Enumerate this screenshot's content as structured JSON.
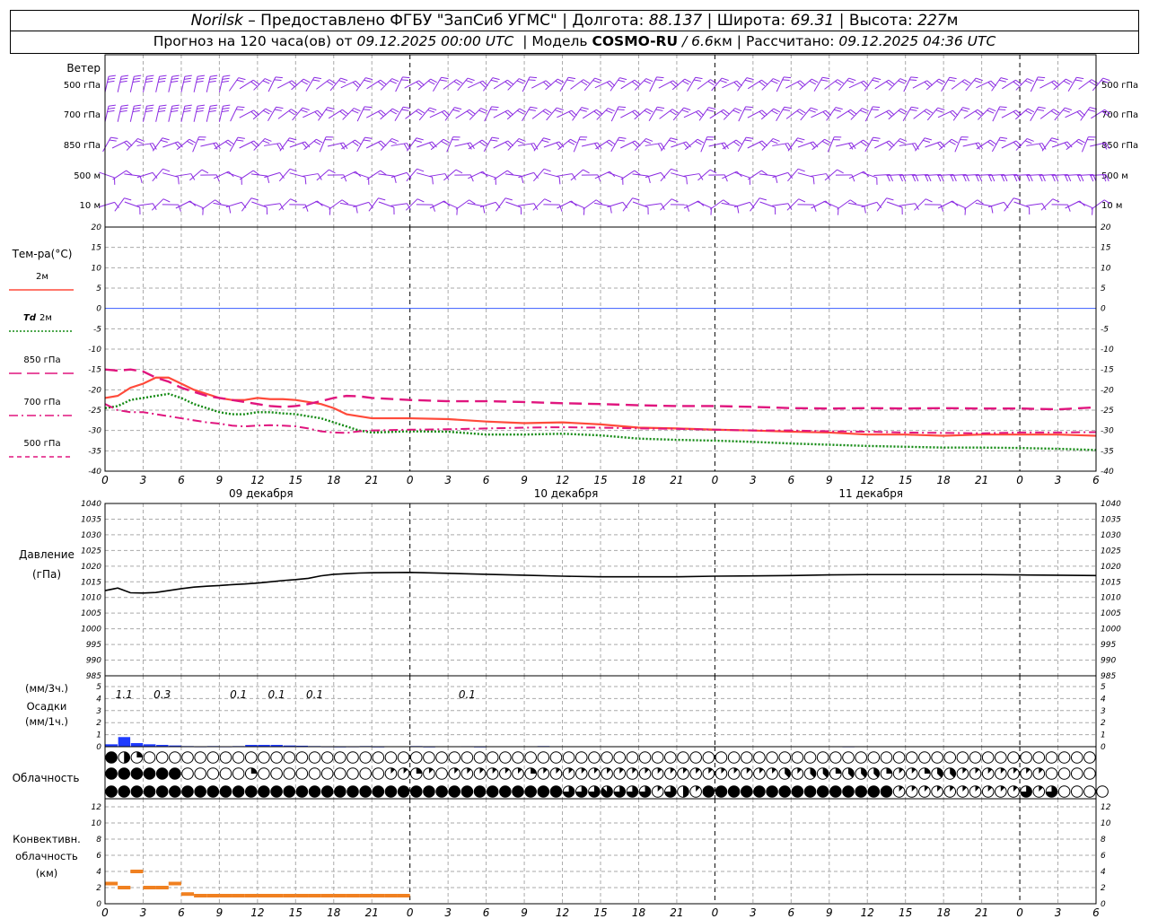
{
  "header": {
    "station": "Norilsk",
    "dash": " – ",
    "provider": "Предоставлено ФГБУ \"ЗапСиб УГМС\"",
    "lon_label": "Долгота:",
    "lon_value": "88.137",
    "lat_label": "Широта:",
    "lat_value": "69.31",
    "alt_label": "Высота:",
    "alt_value": "227",
    "alt_unit": "м",
    "sep": " | ",
    "forecast_prefix": "Прогноз на 120 часа(ов) от",
    "forecast_start": "09.12.2025 00:00 UTC",
    "model_label": "| Модель",
    "model_name": "COSMO-RU",
    "model_res": "/ 6.6",
    "model_unit": "км",
    "calc_label": "| Рассчитано:",
    "calc_time": "09.12.2025 04:36 UTC"
  },
  "wind_panel": {
    "title": "Ветер",
    "levels": [
      "500 гПа",
      "700 гПа",
      "850 гПа",
      "500 м",
      "10 м"
    ],
    "barb_color": "#8b2be2"
  },
  "temp_panel": {
    "title": "Тем-ра(°C)",
    "legend": [
      {
        "label": "2м",
        "color": "#ff4a3a",
        "dash": "solid"
      },
      {
        "label_it": "Td",
        "label": "2м",
        "color": "#138a13",
        "dash": "dotted"
      },
      {
        "label": "850 гПа",
        "color": "#e0157e",
        "dash": "longdash"
      },
      {
        "label": "700 гПа",
        "color": "#e0157e",
        "dash": "dashdot"
      },
      {
        "label": "500 гПа",
        "color": "#e0157e",
        "dash": "dash"
      }
    ],
    "y_ticks": [
      "20",
      "15",
      "10",
      "5",
      "0",
      "-5",
      "-10",
      "-15",
      "-20",
      "-25",
      "-30",
      "-35",
      "-40"
    ],
    "zero_line_color": "#3a5bff"
  },
  "time_axis": {
    "hour_labels": [
      "0",
      "3",
      "6",
      "9",
      "12",
      "15",
      "18",
      "21",
      "0",
      "3",
      "6",
      "9",
      "12",
      "15",
      "18",
      "21",
      "0",
      "3",
      "6",
      "9",
      "12",
      "15",
      "18",
      "21",
      "0",
      "3",
      "6"
    ],
    "day_labels": [
      "09 декабря",
      "10 декабря",
      "11 декабря"
    ]
  },
  "pressure_panel": {
    "title_line1": "Давление",
    "title_line2": "(гПа)",
    "y_ticks": [
      "1040",
      "1035",
      "1030",
      "1025",
      "1020",
      "1015",
      "1010",
      "1005",
      "1000",
      "995",
      "990",
      "985"
    ]
  },
  "precip_panel": {
    "title_line1": "(мм/3ч.)",
    "title_line2": "Осадки",
    "title_line3": "(мм/1ч.)",
    "y_ticks": [
      "5",
      "4",
      "3",
      "2",
      "1",
      "0"
    ],
    "sums": [
      {
        "hour": 1.5,
        "text": "1.1"
      },
      {
        "hour": 4.5,
        "text": "0.3"
      },
      {
        "hour": 10.5,
        "text": "0.1"
      },
      {
        "hour": 13.5,
        "text": "0.1"
      },
      {
        "hour": 16.5,
        "text": "0.1"
      },
      {
        "hour": 28.5,
        "text": "0.1"
      }
    ]
  },
  "cloud_panel": {
    "title": "Облачность"
  },
  "conv_panel": {
    "title_line1": "Конвективн.",
    "title_line2": "облачность",
    "title_line3": "(км)",
    "y_ticks": [
      "12",
      "10",
      "8",
      "6",
      "4",
      "2",
      "0"
    ]
  },
  "chart_data": {
    "type": "line",
    "x_unit": "hours from 09.12.2025 00:00 UTC",
    "x_range": [
      0,
      78
    ],
    "temperature": {
      "ylim": [
        -40,
        20
      ],
      "series": [
        {
          "name": "2м",
          "x": [
            0,
            1,
            2,
            3,
            4,
            5,
            6,
            7,
            8,
            9,
            10,
            11,
            12,
            13,
            14,
            15,
            16,
            17,
            18,
            19,
            20,
            21,
            24,
            27,
            30,
            33,
            36,
            39,
            42,
            45,
            48,
            51,
            54,
            57,
            60,
            63,
            66,
            69,
            72,
            75,
            78
          ],
          "values": [
            -22,
            -21.5,
            -19.5,
            -18.5,
            -17,
            -17,
            -18.5,
            -20,
            -21,
            -22,
            -22.5,
            -22.5,
            -22,
            -22.3,
            -22.3,
            -22.5,
            -23,
            -23.5,
            -24.5,
            -26,
            -26.5,
            -27,
            -27,
            -27.2,
            -27.8,
            -28.2,
            -28,
            -28.5,
            -29.3,
            -29.5,
            -29.8,
            -30,
            -30.3,
            -30.5,
            -31,
            -31,
            -31.3,
            -31,
            -31,
            -31,
            -31.3
          ]
        },
        {
          "name": "Td 2м",
          "x": [
            0,
            1,
            2,
            3,
            4,
            5,
            6,
            7,
            8,
            9,
            10,
            11,
            12,
            13,
            14,
            15,
            16,
            17,
            18,
            19,
            20,
            21,
            24,
            27,
            30,
            33,
            36,
            39,
            42,
            45,
            48,
            51,
            54,
            57,
            60,
            63,
            66,
            69,
            72,
            75,
            78
          ],
          "values": [
            -24.5,
            -24,
            -22.5,
            -22,
            -21.5,
            -21,
            -22,
            -23.5,
            -24.5,
            -25.5,
            -26,
            -26,
            -25.5,
            -25.5,
            -25.8,
            -26,
            -26.5,
            -27,
            -28,
            -29,
            -30,
            -30.5,
            -30.2,
            -30.3,
            -31,
            -31,
            -30.8,
            -31.2,
            -32,
            -32.3,
            -32.5,
            -32.8,
            -33.2,
            -33.5,
            -33.8,
            -34,
            -34.2,
            -34.2,
            -34.3,
            -34.5,
            -34.8
          ]
        },
        {
          "name": "850 гПа",
          "x": [
            0,
            1,
            2,
            3,
            4,
            5,
            6,
            7,
            8,
            9,
            10,
            11,
            12,
            13,
            14,
            15,
            16,
            17,
            18,
            19,
            20,
            21,
            24,
            27,
            30,
            33,
            36,
            39,
            42,
            45,
            48,
            51,
            54,
            57,
            60,
            63,
            66,
            69,
            72,
            75,
            78
          ],
          "values": [
            -15,
            -15.3,
            -15,
            -15.5,
            -17,
            -18,
            -19.5,
            -20.5,
            -21.5,
            -22,
            -22.5,
            -23,
            -23.5,
            -24,
            -24.2,
            -24,
            -23.5,
            -22.8,
            -22,
            -21.5,
            -21.6,
            -22,
            -22.5,
            -22.8,
            -22.8,
            -23,
            -23.3,
            -23.5,
            -23.8,
            -24,
            -24,
            -24.2,
            -24.5,
            -24.6,
            -24.5,
            -24.6,
            -24.5,
            -24.6,
            -24.6,
            -24.8,
            -24.3
          ]
        },
        {
          "name": "700 гПа",
          "x": [
            0,
            1,
            2,
            3,
            4,
            5,
            6,
            7,
            8,
            9,
            10,
            11,
            12,
            13,
            14,
            15,
            16,
            17,
            18,
            19,
            20,
            21,
            24,
            27,
            30,
            33,
            36,
            39,
            42,
            45,
            48,
            51,
            54,
            57,
            60,
            63,
            66,
            69,
            72,
            75,
            78
          ],
          "values": [
            -23.5,
            -25,
            -25.5,
            -25.5,
            -26,
            -26.5,
            -27,
            -27.5,
            -28,
            -28.3,
            -28.8,
            -29,
            -28.8,
            -28.7,
            -28.8,
            -29,
            -29.5,
            -30.2,
            -30.5,
            -30.6,
            -30.2,
            -30,
            -29.8,
            -29.7,
            -29.5,
            -29.3,
            -29.2,
            -29.3,
            -29.5,
            -29.6,
            -29.8,
            -30,
            -30,
            -30.2,
            -30.3,
            -30.5,
            -30.6,
            -30.7,
            -30.5,
            -30.5,
            -30.4
          ]
        }
      ]
    },
    "pressure": {
      "ylim": [
        985,
        1040
      ],
      "x": [
        0,
        1,
        2,
        3,
        4,
        5,
        6,
        7,
        8,
        9,
        10,
        11,
        12,
        13,
        14,
        15,
        16,
        17,
        18,
        19,
        20,
        21,
        24,
        27,
        30,
        33,
        36,
        39,
        42,
        45,
        48,
        51,
        54,
        57,
        60,
        63,
        66,
        69,
        72,
        75,
        78
      ],
      "values": [
        1012.2,
        1013,
        1011.5,
        1011.4,
        1011.6,
        1012.2,
        1012.8,
        1013.3,
        1013.6,
        1013.8,
        1014.1,
        1014.3,
        1014.6,
        1015,
        1015.4,
        1015.7,
        1016.1,
        1016.9,
        1017.4,
        1017.6,
        1017.8,
        1017.9,
        1018,
        1017.7,
        1017.4,
        1017.1,
        1016.8,
        1016.6,
        1016.6,
        1016.6,
        1016.8,
        1016.9,
        1017,
        1017.2,
        1017.3,
        1017.3,
        1017.3,
        1017.3,
        1017.2,
        1017.1,
        1017
      ]
    },
    "precip_hourly_mm": {
      "ylim": [
        0,
        5
      ],
      "x": [
        0,
        1,
        2,
        3,
        4,
        5,
        6,
        7,
        8,
        9,
        10,
        11,
        12,
        13,
        14,
        15,
        16,
        17,
        18,
        19,
        20,
        21,
        22,
        23,
        24,
        25,
        26,
        27,
        28,
        29,
        30,
        31,
        32,
        33,
        34,
        35,
        36,
        37,
        38,
        39,
        40,
        41,
        42,
        43,
        44,
        45,
        46,
        47,
        48,
        49,
        50,
        51,
        52,
        53,
        54,
        55,
        56,
        57,
        58,
        59,
        60,
        61,
        62,
        63,
        64,
        65,
        66,
        67,
        68,
        69,
        70,
        71,
        72,
        73,
        74,
        75,
        76,
        77
      ],
      "values": [
        0.2,
        0.8,
        0.3,
        0.2,
        0.15,
        0.1,
        0.05,
        0.03,
        0.05,
        0.03,
        0.05,
        0.15,
        0.15,
        0.15,
        0.1,
        0.08,
        0.05,
        0.03,
        0.02,
        0.03,
        0.05,
        0.02,
        0,
        0,
        0.05,
        0.02,
        0,
        0,
        0.04,
        0.02,
        0,
        0,
        0,
        0,
        0.05,
        0,
        0,
        0,
        0,
        0,
        0,
        0,
        0,
        0,
        0,
        0,
        0,
        0,
        0,
        0,
        0,
        0,
        0,
        0,
        0,
        0,
        0,
        0,
        0.03,
        0,
        0,
        0,
        0,
        0,
        0,
        0,
        0,
        0,
        0,
        0,
        0,
        0,
        0,
        0,
        0,
        0,
        0,
        0
      ]
    },
    "cloud_cover_octas": {
      "note": "rows top to bottom: upper, middle, lower",
      "upper": [
        8,
        4,
        2,
        0,
        0,
        0,
        0,
        0,
        0,
        0,
        0,
        0,
        0,
        0,
        0,
        0,
        0,
        0,
        0,
        0,
        0,
        0,
        0,
        0,
        0,
        0,
        0,
        0,
        0,
        0,
        0,
        0,
        0,
        0,
        0,
        0,
        0,
        0,
        0,
        0,
        0,
        0,
        0,
        0,
        0,
        0,
        0,
        0,
        0,
        0,
        0,
        0,
        0,
        0,
        0,
        0,
        0,
        0,
        0,
        0,
        0,
        0,
        0,
        0,
        0,
        0,
        0,
        0,
        0,
        0,
        0,
        0,
        0,
        0,
        0,
        0,
        0,
        0
      ],
      "middle": [
        8,
        8,
        8,
        8,
        8,
        8,
        0,
        0,
        0,
        0,
        0,
        2,
        0,
        0,
        0,
        0,
        0,
        0,
        0,
        0,
        0,
        0,
        1,
        1,
        2,
        1,
        0,
        1,
        1,
        1,
        1,
        1,
        1,
        2,
        1,
        1,
        1,
        1,
        1,
        1,
        1,
        1,
        1,
        1,
        1,
        1,
        1,
        1,
        1,
        1,
        1,
        1,
        1,
        3,
        1,
        3,
        3,
        2,
        3,
        3,
        3,
        2,
        1,
        1,
        2,
        3,
        3,
        1,
        1,
        1,
        1,
        1,
        1,
        1,
        0,
        0,
        0,
        0
      ],
      "lower": [
        8,
        8,
        8,
        8,
        8,
        8,
        8,
        8,
        8,
        8,
        8,
        8,
        8,
        8,
        8,
        8,
        8,
        8,
        8,
        8,
        8,
        8,
        8,
        8,
        8,
        8,
        8,
        8,
        8,
        8,
        8,
        8,
        8,
        8,
        8,
        8,
        6,
        6,
        6,
        7,
        6,
        6,
        6,
        1,
        6,
        4,
        1,
        8,
        8,
        8,
        8,
        8,
        8,
        8,
        8,
        8,
        8,
        8,
        8,
        8,
        8,
        8,
        1,
        1,
        1,
        1,
        1,
        1,
        1,
        1,
        1,
        1,
        6,
        1,
        6,
        0,
        0,
        0,
        0
      ]
    },
    "convective_cloud_km": {
      "ylim": [
        0,
        13
      ],
      "x": [
        0,
        1,
        2,
        3,
        4,
        5,
        6,
        7,
        8,
        9,
        10,
        11,
        12,
        13,
        14,
        15,
        16,
        17,
        18,
        19,
        20,
        21,
        22,
        23
      ],
      "values": [
        2.5,
        2,
        4,
        2,
        2,
        2.5,
        1.2,
        1,
        1,
        1,
        1,
        1,
        1,
        1,
        1,
        1,
        1,
        1,
        1,
        1,
        1,
        1,
        1,
        1
      ]
    }
  }
}
